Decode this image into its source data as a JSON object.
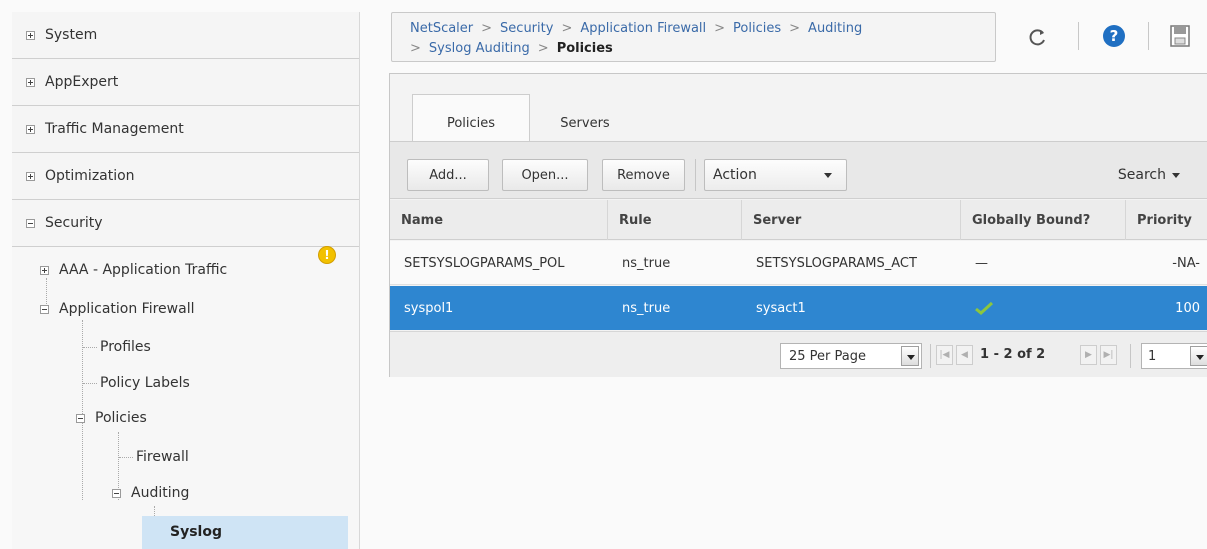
{
  "nav": {
    "top_items": [
      {
        "label": "System",
        "state": "collapsed"
      },
      {
        "label": "AppExpert",
        "state": "collapsed"
      },
      {
        "label": "Traffic Management",
        "state": "collapsed"
      },
      {
        "label": "Optimization",
        "state": "collapsed"
      },
      {
        "label": "Security",
        "state": "expanded"
      }
    ],
    "security_children": {
      "aaa": "AAA - Application Traffic",
      "appfw": "Application Firewall",
      "profiles": "Profiles",
      "policy_labels": "Policy Labels",
      "policies": "Policies",
      "firewall": "Firewall",
      "auditing": "Auditing",
      "syslog": "Syslog"
    },
    "warning_glyph": "!"
  },
  "breadcrumb": {
    "items": [
      "NetScaler",
      "Security",
      "Application Firewall",
      "Policies",
      "Auditing",
      "Syslog Auditing"
    ],
    "current": "Policies",
    "separator": ">"
  },
  "tabs": [
    "Policies",
    "Servers"
  ],
  "toolbar": {
    "add": "Add...",
    "open": "Open...",
    "remove": "Remove",
    "action": "Action",
    "search": "Search"
  },
  "table": {
    "columns": [
      "Name",
      "Rule",
      "Server",
      "Globally Bound?",
      "Priority"
    ],
    "rows": [
      {
        "name": "SETSYSLOGPARAMS_POL",
        "rule": "ns_true",
        "server": "SETSYSLOGPARAMS_ACT",
        "bound": "—",
        "priority": "-NA-"
      },
      {
        "name": "syspol1",
        "rule": "ns_true",
        "server": "sysact1",
        "bound": "check-icon",
        "priority": "100"
      }
    ]
  },
  "pager": {
    "per_page": "25 Per Page",
    "range": "1 - 2 of 2",
    "page": "1"
  },
  "colors": {
    "selected_row": "#2e86d0",
    "link": "#3a6aa8",
    "help_icon": "#1f6fc2",
    "check": "#8cc63e",
    "warning": "#f2c100"
  },
  "icons": [
    "refresh-icon",
    "help-icon",
    "save-icon",
    "check-icon",
    "warning-icon"
  ]
}
